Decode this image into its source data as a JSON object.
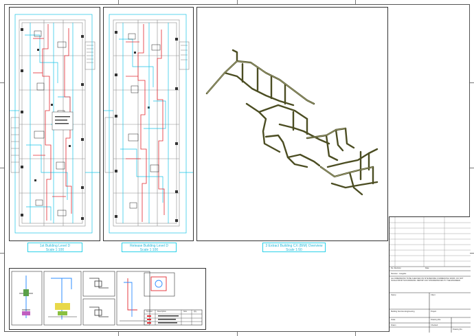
{
  "views": {
    "plan1": {
      "title": "1st Building Level D",
      "scale": "Scale 1:100"
    },
    "plan2": {
      "title": "Release Building Level D",
      "scale": "Scale 1:100"
    },
    "iso": {
      "title": "3 Extract Building CX (BIM) Overview",
      "scale": "Scale 1:50"
    }
  },
  "titleblock": {
    "rev_label": "No.  Revision",
    "date_label": "Date",
    "rev_entry": "Revision - Ausgabe",
    "stamp_label": "Stamp",
    "notes": "ALL DIMENSIONS TO BE CHECKED ON SITE BEFORE COMMENCING WORK. DO NOT SCALE FROM THIS DRAWING. REPORT ANY DISCREPANCIES TO THE ENGINEER.",
    "client_label": "Client",
    "project_label": "Project",
    "drawing_label": "Drawing title",
    "company": "Building Services Engineering",
    "scale_label": "Scale",
    "drawn_label": "Drawn",
    "checked_label": "Checked",
    "drawing_no_label": "Drawing No."
  },
  "legend": {
    "header": [
      "Symbol",
      "Description",
      "Size",
      "Qty"
    ]
  }
}
